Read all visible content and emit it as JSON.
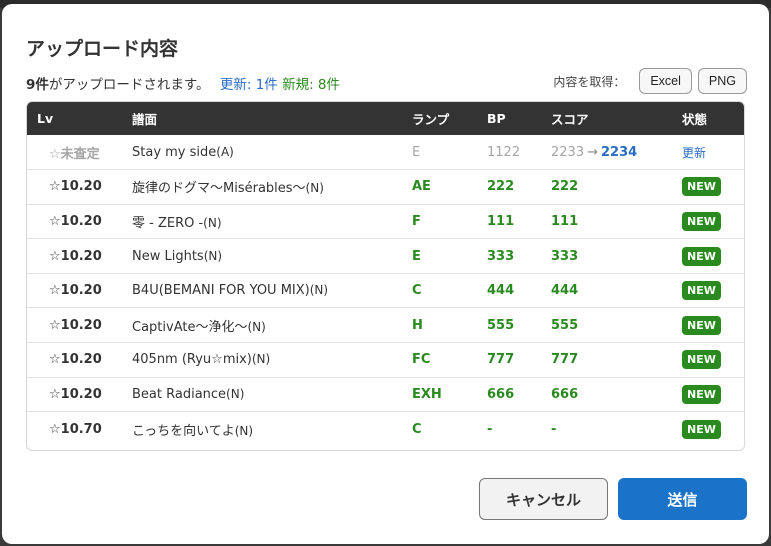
{
  "dialog": {
    "title": "アップロード内容",
    "summary": {
      "count": "9件",
      "suffix": "がアップロードされます。",
      "updated": "更新: 1件",
      "new": "新規: 8件"
    },
    "export": {
      "label": "内容を取得：",
      "excel": "Excel",
      "png": "PNG"
    },
    "cancel_label": "キャンセル",
    "send_label": "送信"
  },
  "table": {
    "headers": [
      "Lv",
      "譜面",
      "ランプ",
      "BP",
      "スコア",
      "状態"
    ],
    "rows": [
      {
        "lv": "☆未査定",
        "title": "Stay my side",
        "diff": "(A)",
        "lamp": "E",
        "bp": "1122",
        "score_old": "2233",
        "arrow": "→",
        "score": "2234",
        "status": "更新"
      },
      {
        "lv": "☆10.20",
        "title": "旋律のドグマ〜Misérables〜",
        "diff": "(N)",
        "lamp": "AE",
        "bp": "222",
        "score": "222",
        "status": "NEW"
      },
      {
        "lv": "☆10.20",
        "title": "零 - ZERO -",
        "diff": "(N)",
        "lamp": "F",
        "bp": "111",
        "score": "111",
        "status": "NEW"
      },
      {
        "lv": "☆10.20",
        "title": "New Lights",
        "diff": "(N)",
        "lamp": "E",
        "bp": "333",
        "score": "333",
        "status": "NEW"
      },
      {
        "lv": "☆10.20",
        "title": "B4U(BEMANI FOR YOU MIX)",
        "diff": "(N)",
        "lamp": "C",
        "bp": "444",
        "score": "444",
        "status": "NEW"
      },
      {
        "lv": "☆10.20",
        "title": "CaptivAte〜浄化〜",
        "diff": "(N)",
        "lamp": "H",
        "bp": "555",
        "score": "555",
        "status": "NEW"
      },
      {
        "lv": "☆10.20",
        "title": "405nm (Ryu☆mix)",
        "diff": "(N)",
        "lamp": "FC",
        "bp": "777",
        "score": "777",
        "status": "NEW"
      },
      {
        "lv": "☆10.20",
        "title": "Beat Radiance",
        "diff": "(N)",
        "lamp": "EXH",
        "bp": "666",
        "score": "666",
        "status": "NEW"
      },
      {
        "lv": "☆10.70",
        "title": "こっちを向いてよ",
        "diff": "(N)",
        "lamp": "C",
        "bp": "-",
        "score": "-",
        "status": "NEW"
      }
    ]
  }
}
